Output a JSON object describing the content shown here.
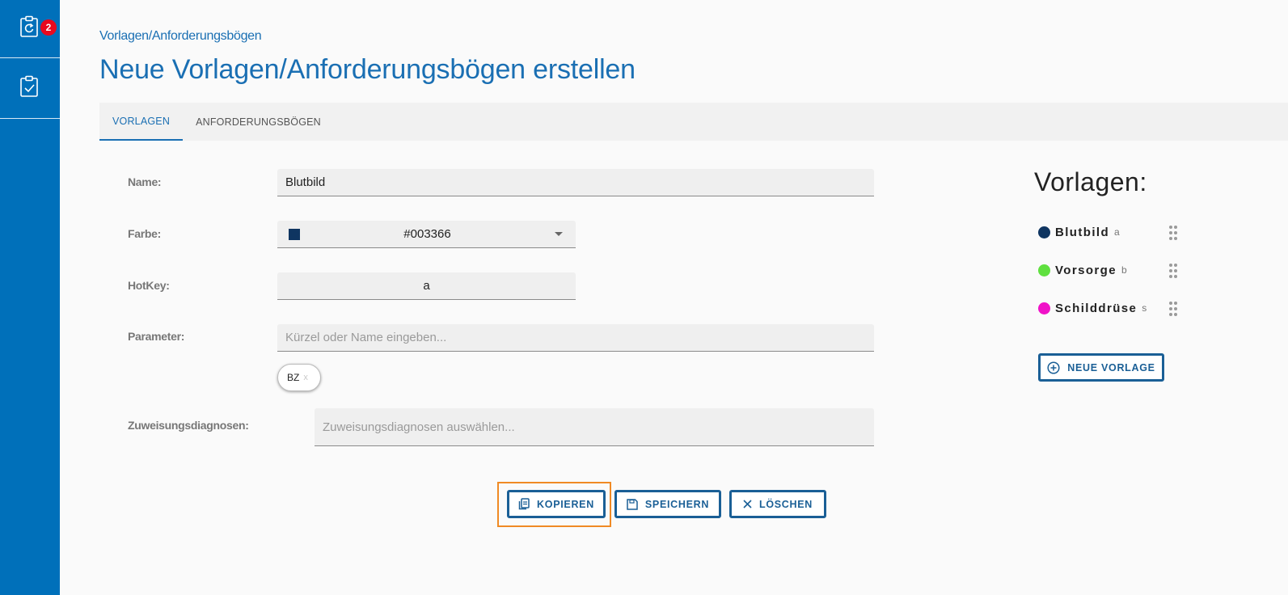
{
  "sidebar": {
    "items": [
      {
        "icon": "clipboard-refresh-icon",
        "badge": "2"
      },
      {
        "icon": "clipboard-check-icon"
      }
    ]
  },
  "breadcrumb": "Vorlagen/Anforderungsbögen",
  "page_title": "Neue Vorlagen/Anforderungsbögen erstellen",
  "tabs": [
    {
      "label": "VORLAGEN",
      "active": true
    },
    {
      "label": "ANFORDERUNGSBÖGEN",
      "active": false
    }
  ],
  "form": {
    "name_label": "Name:",
    "name_value": "Blutbild",
    "farbe_label": "Farbe:",
    "farbe_value": "#003366",
    "farbe_swatch": "#0f3561",
    "hotkey_label": "HotKey:",
    "hotkey_value": "a",
    "parameter_label": "Parameter:",
    "parameter_placeholder": "Kürzel oder Name eingeben...",
    "parameter_chips": [
      {
        "label": "BZ",
        "remove": "x"
      }
    ],
    "diagnosen_label": "Zuweisungsdiagnosen:",
    "diagnosen_placeholder": "Zuweisungsdiagnosen auswählen..."
  },
  "actions": {
    "copy_label": "KOPIEREN",
    "save_label": "SPEICHERN",
    "delete_label": "LÖSCHEN"
  },
  "vorlagen": {
    "title": "Vorlagen:",
    "items": [
      {
        "name": "Blutbild",
        "key": "a",
        "color": "#0f3561"
      },
      {
        "name": "Vorsorge",
        "key": "b",
        "color": "#5fe03f"
      },
      {
        "name": "Schilddrüse",
        "key": "s",
        "color": "#f012c8"
      }
    ],
    "new_label": "NEUE VORLAGE"
  },
  "colors": {
    "sidebar": "#0070ba",
    "accent": "#1a6fb3",
    "button_border": "#1a5f96",
    "highlight": "#f08a24",
    "badge": "#e8091e"
  }
}
